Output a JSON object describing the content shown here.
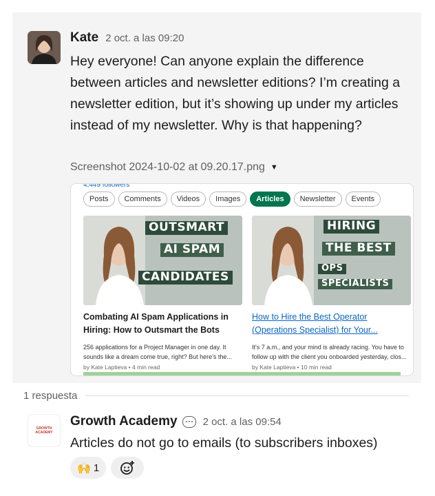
{
  "message": {
    "author": "Kate",
    "timestamp": "2 oct. a las 09:20",
    "text": "Hey everyone! Can anyone explain the difference between articles and newsletter editions? I’m creating a newsletter edition, but it’s showing up under my articles instead of my newsletter. Why is that happening?",
    "attachment": {
      "filename": "Screenshot 2024-10-02 at 09.20.17.png",
      "followers": "4,449 followers",
      "tabs": [
        "Posts",
        "Comments",
        "Videos",
        "Images",
        "Articles",
        "Newsletter",
        "Events"
      ],
      "active_tab": "Articles",
      "cards": [
        {
          "banner": [
            "OUTSMART",
            "AI SPAM",
            "CANDIDATES"
          ],
          "title": "Combating AI Spam Applications in Hiring: How to Outsmart the Bots and...",
          "description": "256 applications for a Project Manager in one day. It sounds like a dream come true, right? But here's the...",
          "meta": "by Kate Laptieva • 4 min read"
        },
        {
          "banner": [
            "HIRING",
            "THE BEST",
            "OPS",
            "SPECIALISTS"
          ],
          "title": "How to Hire the Best Operator (Operations Specialist) for Your...",
          "description": "It's 7 a.m., and your mind is already racing. You have to follow up with the client you onboarded yesterday, clos...",
          "meta": "by Kate Laptieva • 10 min read"
        }
      ]
    }
  },
  "replies_label": "1 respuesta",
  "reply": {
    "author": "Growth Academy",
    "timestamp": "2 oct. a las 09:54",
    "text": "Articles do not go to emails (to subscribers inboxes)",
    "avatar_logo": "GROWTH ACADEMY",
    "reactions": [
      {
        "emoji": "🙌",
        "count": "1"
      }
    ]
  },
  "colors": {
    "accent_green": "#01754f",
    "link_blue": "#0a66c2",
    "banner_green": "#2d4a3a",
    "reaction_gold": "#e7a712"
  }
}
